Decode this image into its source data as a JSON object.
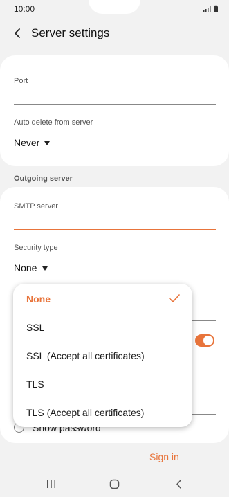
{
  "status_bar": {
    "time": "10:00"
  },
  "header": {
    "title": "Server settings"
  },
  "fields": {
    "port_label": "Port",
    "auto_delete_label": "Auto delete from server",
    "auto_delete_value": "Never"
  },
  "outgoing": {
    "section_title": "Outgoing server",
    "smtp_label": "SMTP server",
    "security_type_label": "Security type",
    "security_type_value": "None"
  },
  "dropdown": {
    "options": [
      {
        "label": "None",
        "selected": true
      },
      {
        "label": "SSL",
        "selected": false
      },
      {
        "label": "SSL (Accept all certificates)",
        "selected": false
      },
      {
        "label": "TLS",
        "selected": false
      },
      {
        "label": "TLS (Accept all certificates)",
        "selected": false
      }
    ]
  },
  "show_password_label": "Show password",
  "sign_in_label": "Sign in",
  "toggle_on": true,
  "colors": {
    "accent": "#e8743b",
    "background": "#f2f2f2",
    "card": "#ffffff"
  },
  "icons": [
    "back-arrow-icon",
    "signal-icon",
    "battery-icon",
    "check-icon",
    "recent-apps-icon",
    "home-icon",
    "back-nav-icon"
  ]
}
